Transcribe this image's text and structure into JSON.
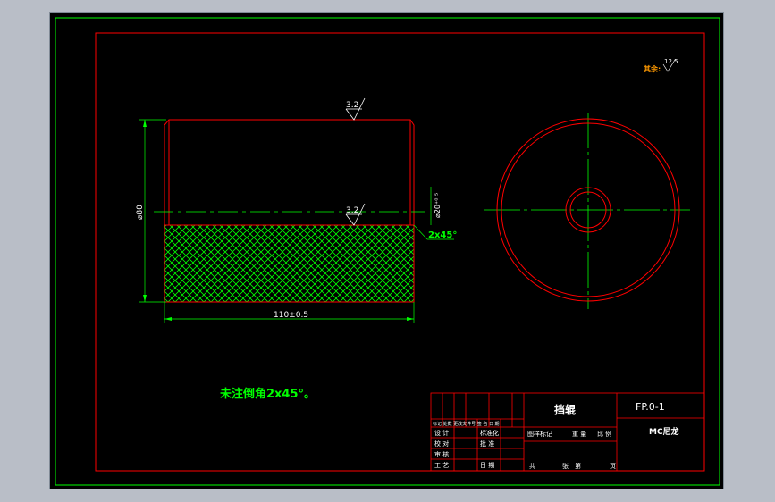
{
  "drawing": {
    "surface_finish_top": "3.2",
    "surface_finish_mid": "3.2",
    "dim_diameter_outer": "⌀80",
    "dim_diameter_bore": "⌀20⁺⁰·⁵",
    "dim_length": "110±0.5",
    "dim_chamfer": "2x45°",
    "remaining_finish_label": "其余:",
    "remaining_finish_value": "12.5",
    "note": "未注倒角2x45°。"
  },
  "title_block": {
    "part_name": "挡辊",
    "drawing_number": "FP.0-1",
    "material": "MC尼龙",
    "row_design": "设 计",
    "row_check": "校 对",
    "row_review": "审 核",
    "row_process": "工 艺",
    "standardize": "标准化",
    "approve": "批 准",
    "date": "日 期",
    "stage_mark": "图样标记",
    "weight": "重 量",
    "scale": "比 例",
    "total": "共",
    "sheet": "张",
    "sheet_no": "第",
    "page": "页",
    "rev_header": "标记 处数 更改文件号 签 名 日 期"
  },
  "colors": {
    "frame": "#ff0000",
    "hatch": "#00ff00",
    "dimension": "#00ff00",
    "centerline": "#00ff00",
    "text": "#ffffff",
    "part_outline": "#ff0000"
  }
}
